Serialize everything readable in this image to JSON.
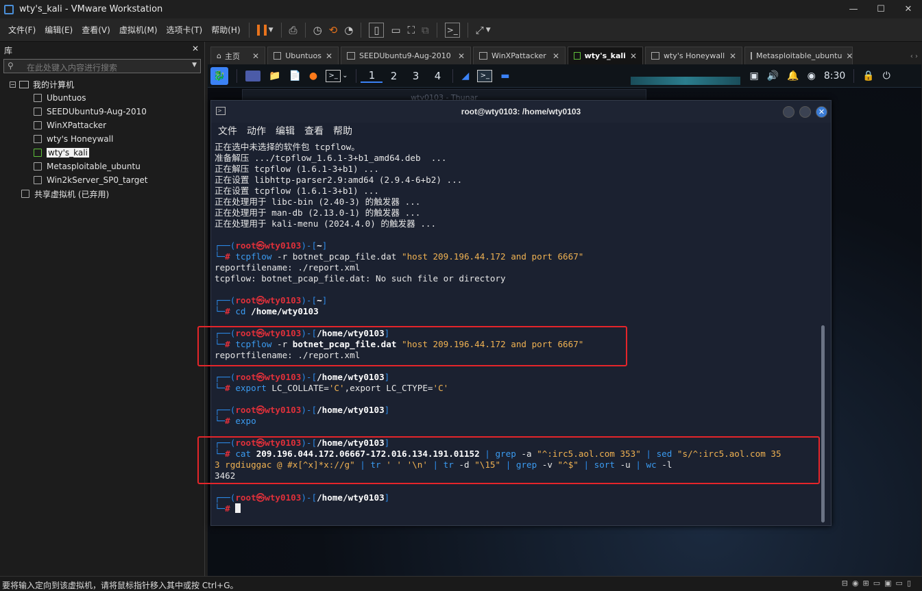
{
  "window": {
    "title": "wty's_kali - VMware Workstation",
    "minimize": "—",
    "maximize": "☐",
    "close": "✕"
  },
  "menu": [
    "文件(F)",
    "编辑(E)",
    "查看(V)",
    "虚拟机(M)",
    "选项卡(T)",
    "帮助(H)"
  ],
  "library": {
    "title": "库",
    "close": "✕",
    "search_placeholder": "在此处键入内容进行搜索",
    "root": "我的计算机",
    "items": [
      "Ubuntuos",
      "SEEDUbuntu9-Aug-2010",
      "WinXPattacker",
      "wty's Honeywall",
      "wty's_kali",
      "Metasploitable_ubuntu",
      "Win2kServer_SP0_target"
    ],
    "selected": "wty's_kali",
    "shared": "共享虚拟机 (已弃用)"
  },
  "tabs": [
    {
      "label": "主页",
      "active": false
    },
    {
      "label": "Ubuntuos",
      "active": false
    },
    {
      "label": "SEEDUbuntu9-Aug-2010",
      "active": false
    },
    {
      "label": "WinXPattacker",
      "active": false
    },
    {
      "label": "wty's_kali",
      "active": true
    },
    {
      "label": "wty's Honeywall",
      "active": false
    },
    {
      "label": "Metasploitable_ubuntu",
      "active": false
    }
  ],
  "kali_panel": {
    "workspaces": [
      "1",
      "2",
      "3",
      "4"
    ],
    "active_workspace": "1",
    "clock": "8:30"
  },
  "background_window": {
    "title": "wty0103 - Thunar"
  },
  "terminal": {
    "title": "root@wty0103: /home/wty0103",
    "menu": [
      "文件",
      "动作",
      "编辑",
      "查看",
      "帮助"
    ],
    "lines": [
      {
        "type": "out",
        "text": "正在选中未选择的软件包 tcpflow。"
      },
      {
        "type": "out",
        "text": "准备解压 .../tcpflow_1.6.1-3+b1_amd64.deb  ..."
      },
      {
        "type": "out",
        "text": "正在解压 tcpflow (1.6.1-3+b1) ..."
      },
      {
        "type": "out",
        "text": "正在设置 libhttp-parser2.9:amd64 (2.9.4-6+b2) ..."
      },
      {
        "type": "out",
        "text": "正在设置 tcpflow (1.6.1-3+b1) ..."
      },
      {
        "type": "out",
        "text": "正在处理用于 libc-bin (2.40-3) 的触发器 ..."
      },
      {
        "type": "out",
        "text": "正在处理用于 man-db (2.13.0-1) 的触发器 ..."
      },
      {
        "type": "out",
        "text": "正在处理用于 kali-menu (2024.4.0) 的触发器 ..."
      },
      {
        "type": "blank",
        "text": ""
      },
      {
        "type": "prompt",
        "user": "root㉿wty0103",
        "dir": "~"
      },
      {
        "type": "cmd",
        "parts": [
          [
            "cm",
            "tcpflow"
          ],
          [
            "",
            " -r botnet_pcap_file.dat "
          ],
          [
            "st",
            "\"host 209.196.44.172 and port 6667\""
          ]
        ]
      },
      {
        "type": "out",
        "text": "reportfilename: ./report.xml"
      },
      {
        "type": "out",
        "text": "tcpflow: botnet_pcap_file.dat: No such file or directory"
      },
      {
        "type": "blank",
        "text": ""
      },
      {
        "type": "prompt",
        "user": "root㉿wty0103",
        "dir": "~"
      },
      {
        "type": "cmd",
        "parts": [
          [
            "cm",
            "cd"
          ],
          [
            "",
            " "
          ],
          [
            "bd",
            "/home/wty0103"
          ]
        ]
      },
      {
        "type": "blank",
        "text": ""
      },
      {
        "type": "prompt",
        "user": "root㉿wty0103",
        "dir": "/home/wty0103"
      },
      {
        "type": "cmd",
        "parts": [
          [
            "cm",
            "tcpflow"
          ],
          [
            "",
            " -r "
          ],
          [
            "bd",
            "botnet_pcap_file.dat"
          ],
          [
            "",
            " "
          ],
          [
            "st",
            "\"host 209.196.44.172 and port 6667\""
          ]
        ]
      },
      {
        "type": "out",
        "text": "reportfilename: ./report.xml"
      },
      {
        "type": "blank",
        "text": ""
      },
      {
        "type": "prompt",
        "user": "root㉿wty0103",
        "dir": "/home/wty0103"
      },
      {
        "type": "cmd",
        "parts": [
          [
            "cm",
            "export"
          ],
          [
            "",
            " LC_COLLATE="
          ],
          [
            "st",
            "'C'"
          ],
          [
            "",
            ",export LC_CTYPE="
          ],
          [
            "st",
            "'C'"
          ]
        ]
      },
      {
        "type": "blank",
        "text": ""
      },
      {
        "type": "prompt",
        "user": "root㉿wty0103",
        "dir": "/home/wty0103"
      },
      {
        "type": "cmd",
        "parts": [
          [
            "cm",
            "expo"
          ]
        ]
      },
      {
        "type": "blank",
        "text": ""
      },
      {
        "type": "prompt",
        "user": "root㉿wty0103",
        "dir": "/home/wty0103"
      },
      {
        "type": "cmd",
        "parts": [
          [
            "cm",
            "cat"
          ],
          [
            "",
            " "
          ],
          [
            "bd",
            "209.196.044.172.06667-172.016.134.191.01152"
          ],
          [
            "pr",
            " | "
          ],
          [
            "cm",
            "grep"
          ],
          [
            "",
            " -a "
          ],
          [
            "st",
            "\"^:irc5.aol.com 353\""
          ],
          [
            "pr",
            " | "
          ],
          [
            "cm",
            "sed"
          ],
          [
            "",
            " "
          ],
          [
            "st",
            "\"s/^:irc5.aol.com 35"
          ]
        ]
      },
      {
        "type": "cont",
        "parts": [
          [
            "st",
            "3 rgdiuggac @ #x[^x]*x://g\""
          ],
          [
            "pr",
            " | "
          ],
          [
            "cm",
            "tr"
          ],
          [
            "",
            " "
          ],
          [
            "st",
            "' '"
          ],
          [
            "",
            " "
          ],
          [
            "st",
            "'\\n'"
          ],
          [
            "pr",
            " | "
          ],
          [
            "cm",
            "tr"
          ],
          [
            "",
            " -d "
          ],
          [
            "st",
            "\"\\15\""
          ],
          [
            "pr",
            " | "
          ],
          [
            "cm",
            "grep"
          ],
          [
            "",
            " -v "
          ],
          [
            "st",
            "\"^$\""
          ],
          [
            "pr",
            " | "
          ],
          [
            "cm",
            "sort"
          ],
          [
            "",
            " -u "
          ],
          [
            "pr",
            "| "
          ],
          [
            "cm",
            "wc"
          ],
          [
            "",
            " -l"
          ]
        ]
      },
      {
        "type": "out",
        "text": "3462"
      },
      {
        "type": "blank",
        "text": ""
      },
      {
        "type": "prompt",
        "user": "root㉿wty0103",
        "dir": "/home/wty0103"
      },
      {
        "type": "cursor",
        "text": ""
      }
    ]
  },
  "statusbar": {
    "text": "要将输入定向到该虚拟机，请将鼠标指针移入其中或按 Ctrl+G。"
  }
}
